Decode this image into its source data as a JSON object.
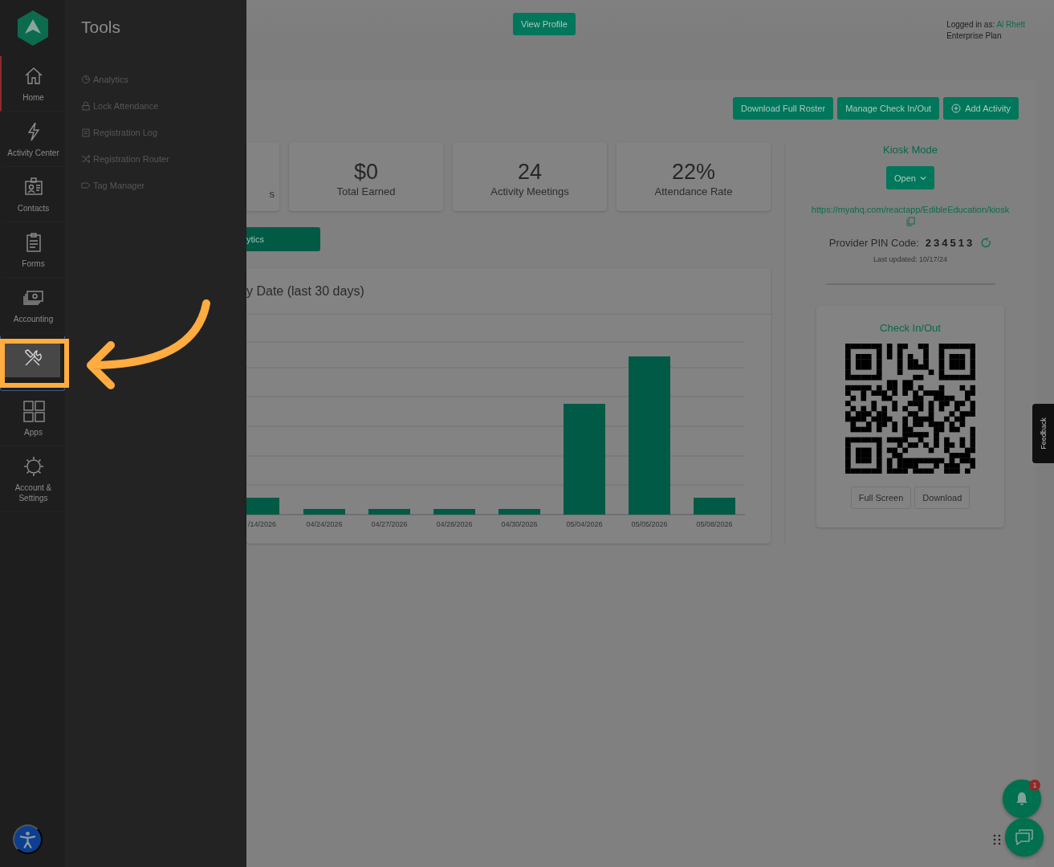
{
  "nav_rail": {
    "items": [
      {
        "label": "Home",
        "current": true,
        "selected": false
      },
      {
        "label": "Activity Center",
        "current": false,
        "selected": false
      },
      {
        "label": "Contacts",
        "current": false,
        "selected": false
      },
      {
        "label": "Forms",
        "current": false,
        "selected": false
      },
      {
        "label": "Accounting",
        "current": false,
        "selected": false
      },
      {
        "current": false,
        "selected": true
      },
      {
        "label": "Apps",
        "current": false,
        "selected": false
      },
      {
        "label": "Account & Settings",
        "current": false,
        "selected": false
      }
    ]
  },
  "tools_panel": {
    "title": "Tools",
    "items": [
      "Analytics",
      "Lock Attendance",
      "Registration Log",
      "Registration Router",
      "Tag Manager"
    ]
  },
  "header": {
    "view_profile": "View Profile",
    "logged_in_label": "Logged in as:",
    "user": "Al Rhett",
    "plan": "Enterprise Plan"
  },
  "actions": [
    {
      "label": "Download Full Roster",
      "kind": "plain"
    },
    {
      "label": "Manage Check In/Out",
      "kind": "plain"
    },
    {
      "label": "Add Activity",
      "kind": "add"
    }
  ],
  "stats": [
    {
      "label": "s"
    },
    {
      "value": "$0",
      "label": "Total Earned"
    },
    {
      "value": "24",
      "label": "Activity Meetings"
    },
    {
      "value": "22%",
      "label": "Attendance Rate"
    }
  ],
  "analytics_button": "ytics",
  "chart": {
    "title": "y Date (last 30 days)",
    "x_labels": [
      "/14/2026",
      "04/24/2026",
      "04/27/2026",
      "04/28/2026",
      "04/30/2026",
      "05/04/2026",
      "05/05/2026",
      "05/08/2026"
    ]
  },
  "kiosk": {
    "title": "Kiosk Mode",
    "open_button": "Open",
    "link": "https://myahq.com/reactapp/EdibleEducation/kiosk",
    "pin_label": "Provider PIN Code:",
    "pin": "234513",
    "last_updated": "Last updated: 10/17/24"
  },
  "check_in": {
    "title": "Check In/Out",
    "buttons": [
      "Full Screen",
      "Download"
    ]
  },
  "feedback": "Feedback",
  "notifications": {
    "badge": "1"
  }
}
